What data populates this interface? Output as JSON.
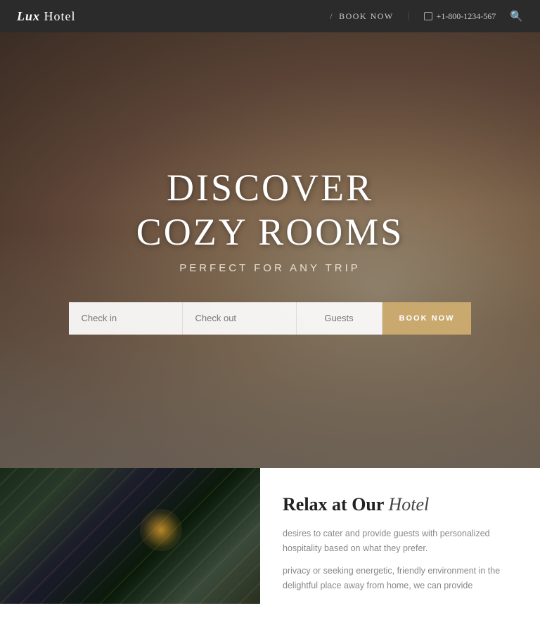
{
  "brand": {
    "name_italic": "Lux",
    "name_rest": " Hotel"
  },
  "navbar": {
    "book_now": "BOOK NOW",
    "phone": "+1-800-1234-567",
    "search_label": "search"
  },
  "hero": {
    "title_line1": "DISCOVER",
    "title_line2": "COZY ROOMS",
    "subtitle": "PERFECT FOR ANY TRIP"
  },
  "booking": {
    "checkin_placeholder": "Check in",
    "checkout_placeholder": "Check out",
    "guests_placeholder": "Guests",
    "book_now_label": "BOOK NOW"
  },
  "lower": {
    "heading_normal": "Relax at Our",
    "heading_italic": "Hotel",
    "para1": "desires to cater and provide guests with personalized hospitality based on what they prefer.",
    "para2": "privacy or seeking energetic, friendly environment in the delightful place away from home, we can provide"
  }
}
